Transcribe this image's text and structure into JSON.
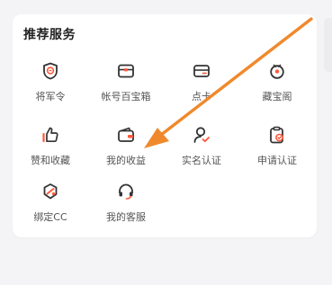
{
  "section": {
    "title": "推荐服务"
  },
  "services": [
    {
      "label": "将军令",
      "icon": "shield-token-icon"
    },
    {
      "label": "帐号百宝箱",
      "icon": "treasure-box-icon"
    },
    {
      "label": "点卡",
      "icon": "card-icon"
    },
    {
      "label": "藏宝阁",
      "icon": "treasure-pavilion-icon"
    },
    {
      "label": "赞和收藏",
      "icon": "thumbs-up-icon"
    },
    {
      "label": "我的收益",
      "icon": "wallet-icon"
    },
    {
      "label": "实名认证",
      "icon": "user-verify-icon"
    },
    {
      "label": "申请认证",
      "icon": "clipboard-check-icon"
    },
    {
      "label": "绑定CC",
      "icon": "cc-link-icon"
    },
    {
      "label": "我的客服",
      "icon": "headset-icon"
    }
  ],
  "colors": {
    "accent": "#ff5a3c",
    "icon_stroke": "#333333",
    "annotation_arrow": "#f0892c"
  }
}
